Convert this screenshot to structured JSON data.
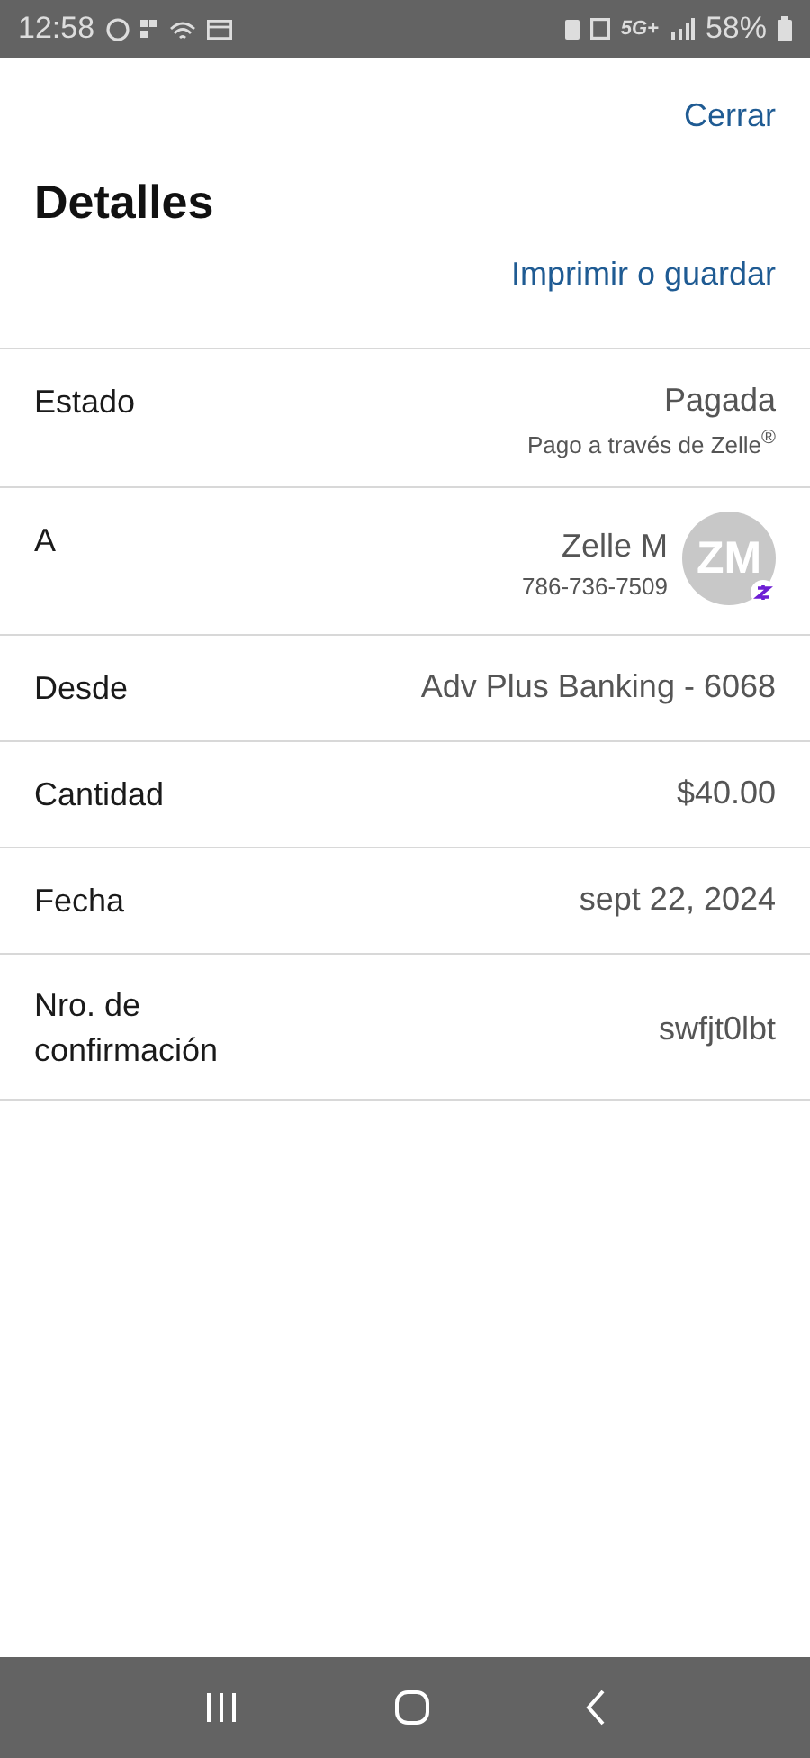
{
  "status_bar": {
    "time": "12:58",
    "battery": "58%",
    "network": "5G+"
  },
  "close": "Cerrar",
  "title": "Detalles",
  "print": "Imprimir o guardar",
  "rows": [
    {
      "kind": "status",
      "label": "Estado",
      "value": "Pagada",
      "note": "Pago a través de Zelle$^{®}$"
    },
    {
      "kind": "contact",
      "label": "A",
      "value": "Zelle M",
      "note": "786-736-7509",
      "initials": "ZM"
    },
    {
      "kind": "plain",
      "label": "Desde",
      "value": "Adv Plus Banking - 6068"
    },
    {
      "kind": "plain",
      "label": "Cantidad",
      "value": "$40.00"
    },
    {
      "kind": "plain",
      "label": "Fecha",
      "value": "sept 22, 2024"
    },
    {
      "kind": "plain",
      "label": "Nro. de confirmación",
      "value": "swfjt0lbt"
    }
  ]
}
